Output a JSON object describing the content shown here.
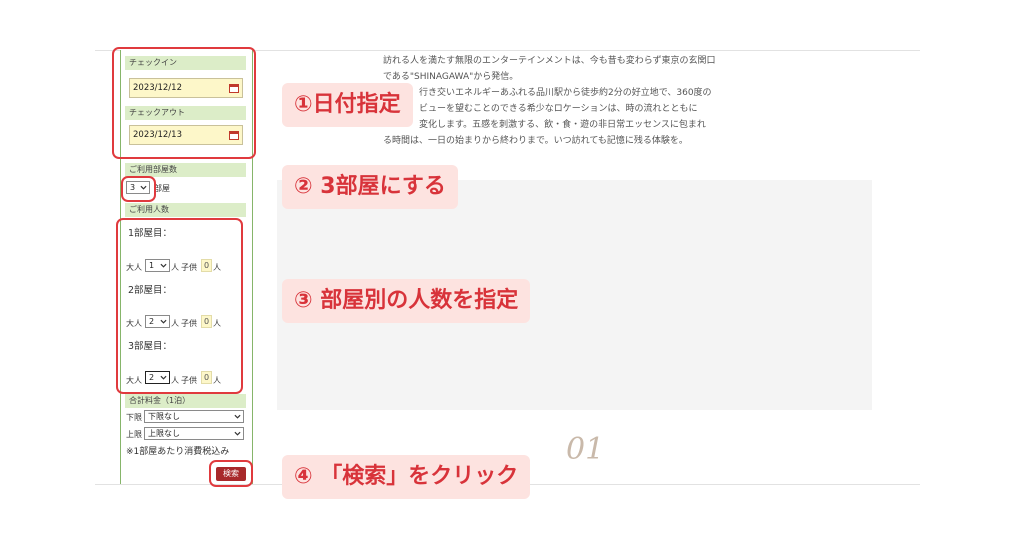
{
  "sidebar": {
    "checkin_label": "チェックイン",
    "checkin_value": "2023/12/12",
    "checkout_label": "チェックアウト",
    "checkout_value": "2023/12/13",
    "rooms_label": "ご利用部屋数",
    "rooms_value": "3",
    "rooms_unit": "部屋",
    "people_label": "ご利用人数",
    "rooms": [
      {
        "title": "1部屋目：",
        "adult_label": "大人",
        "adult_value": "1",
        "unit": "人",
        "child_label": "子供",
        "child_value": "0",
        "child_unit": "人"
      },
      {
        "title": "2部屋目：",
        "adult_label": "大人",
        "adult_value": "2",
        "unit": "人",
        "child_label": "子供",
        "child_value": "0",
        "child_unit": "人"
      },
      {
        "title": "3部屋目：",
        "adult_label": "大人",
        "adult_value": "2",
        "unit": "人",
        "child_label": "子供",
        "child_value": "0",
        "child_unit": "人"
      }
    ],
    "price_label": "合計料金（1泊）",
    "lower_label": "下限",
    "lower_value": "下限なし",
    "upper_label": "上限",
    "upper_value": "上限なし",
    "tax_note": "※1部屋あたり消費税込み",
    "search_button": "検索"
  },
  "callouts": {
    "step1": "①日付指定",
    "step2": "② 3部屋にする",
    "step3": "③ 部屋別の人数を指定",
    "step4": "④ 「検索」をクリック"
  },
  "main": {
    "lines": [
      "訪れる人を満たす無限のエンターテインメントは、今も昔も変わらず東京の玄関口",
      "である\"SHINAGAWA\"から発信。",
      "　　　　行き交いエネルギーあふれる品川駅から徒歩約2分の好立地で、360度の",
      "　　　　ビューを望むことのできる希少なロケーションは、時の流れとともに",
      "　　　　変化します。五感を刺激する、飲・食・遊の非日常エッセンスに包まれ",
      "る時間は、一日の始まりから終わりまで。いつ訪れても記憶に残る体験を。"
    ],
    "section_number": "01"
  },
  "colors": {
    "accent_red": "#e03a3e",
    "label_bg": "#fde3e0",
    "sidebar_green": "#86b56a",
    "header_green": "#dcedc8",
    "field_yellow": "#fdf7c9",
    "button_red": "#a8292b"
  }
}
